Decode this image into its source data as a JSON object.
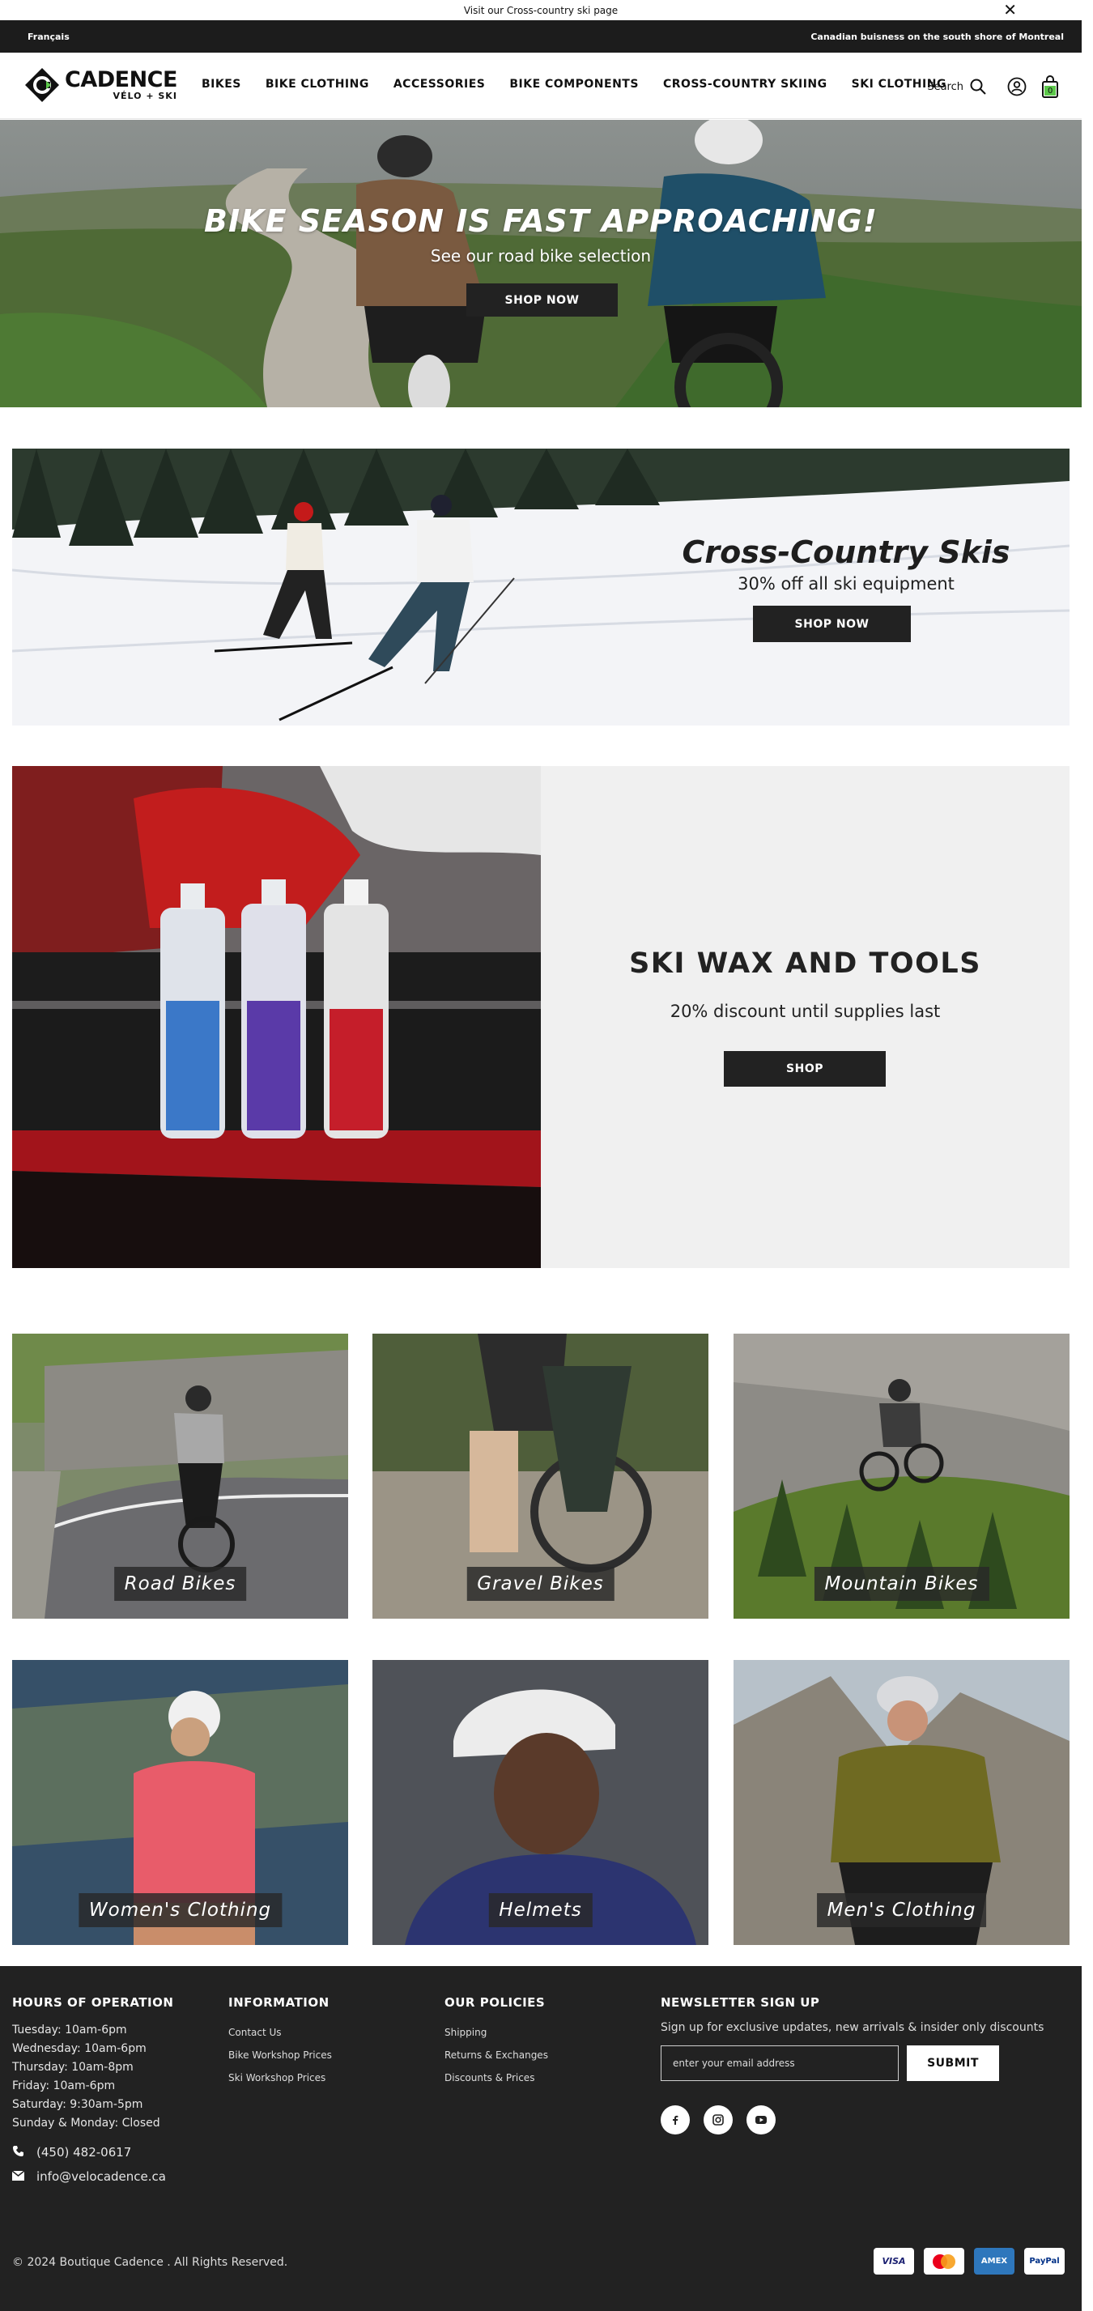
{
  "announcement": {
    "text": "Visit our Cross-country ski page"
  },
  "utility": {
    "language": "Français",
    "tagline": "Canadian buisness on the south shore of Montreal"
  },
  "logo": {
    "name": "CADENCE",
    "sub": "VÉLO + SKI"
  },
  "nav": [
    {
      "label": "BIKES"
    },
    {
      "label": "BIKE CLOTHING"
    },
    {
      "label": "ACCESSORIES"
    },
    {
      "label": "BIKE COMPONENTS"
    },
    {
      "label": "CROSS-COUNTRY SKIING"
    },
    {
      "label": "SKI CLOTHING"
    }
  ],
  "header_tools": {
    "search_label": "Search",
    "cart_count": "0"
  },
  "hero": {
    "title": "BIKE SEASON IS FAST APPROACHING!",
    "subtitle": "See our road bike selection",
    "button": "SHOP NOW"
  },
  "ski_banner": {
    "title": "Cross-Country Skis",
    "subtitle": "30% off all ski equipment",
    "button": "SHOP NOW"
  },
  "wax": {
    "title": "SKI WAX AND TOOLS",
    "subtitle": "20% discount until supplies last",
    "button": "SHOP"
  },
  "categories": [
    {
      "label": "Road Bikes"
    },
    {
      "label": "Gravel Bikes"
    },
    {
      "label": "Mountain Bikes"
    },
    {
      "label": "Women's Clothing"
    },
    {
      "label": "Helmets"
    },
    {
      "label": "Men's Clothing"
    }
  ],
  "footer": {
    "hours": {
      "heading": "HOURS OF OPERATION",
      "lines": [
        "Tuesday: 10am-6pm",
        "Wednesday: 10am-6pm",
        "Thursday: 10am-8pm",
        "Friday: 10am-6pm",
        "Saturday: 9:30am-5pm",
        "Sunday & Monday: Closed"
      ],
      "phone": "(450) 482-0617",
      "email": "info@velocadence.ca"
    },
    "information": {
      "heading": "INFORMATION",
      "links": [
        "Contact Us",
        "Bike Workshop Prices",
        "Ski Workshop Prices"
      ]
    },
    "policies": {
      "heading": "OUR POLICIES",
      "links": [
        "Shipping",
        "Returns & Exchanges",
        "Discounts & Prices"
      ]
    },
    "newsletter": {
      "heading": "NEWSLETTER SIGN UP",
      "text": "Sign up for exclusive updates, new arrivals & insider only discounts",
      "placeholder": "enter your email address",
      "button": "SUBMIT"
    },
    "copyright": "© 2024 Boutique Cadence . All Rights Reserved.",
    "payments": [
      "VISA",
      "AMEX",
      "PayPal"
    ]
  },
  "colors": {
    "dark": "#222222",
    "utility_bar": "#1c1c1c",
    "panel": "#f0f0f0",
    "cart_badge": "#5cc84a"
  }
}
